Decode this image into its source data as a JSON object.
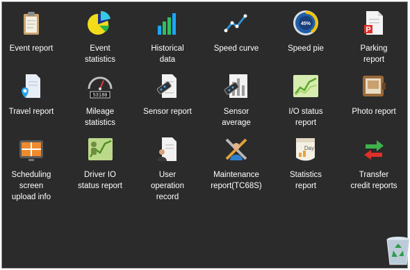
{
  "tiles": [
    {
      "label": "Event report",
      "icon": "clipboard-icon"
    },
    {
      "label": "Event\nstatistics",
      "icon": "pie-chart-icon"
    },
    {
      "label": "Historical\ndata",
      "icon": "bar-chart-icon"
    },
    {
      "label": "Speed curve",
      "icon": "line-chart-icon"
    },
    {
      "label": "Speed pie",
      "icon": "speed-gauge-icon",
      "gauge_text": "45%"
    },
    {
      "label": "Parking\nreport",
      "icon": "parking-document-icon",
      "badge": "P"
    },
    {
      "label": "Travel report",
      "icon": "location-document-icon"
    },
    {
      "label": "Mileage\nstatistics",
      "icon": "odometer-icon",
      "odometer_text": "53180"
    },
    {
      "label": "Sensor report",
      "icon": "sensor-document-icon"
    },
    {
      "label": "Sensor\naverage",
      "icon": "sensor-average-icon"
    },
    {
      "label": "I/O status\nreport",
      "icon": "io-status-chart-icon"
    },
    {
      "label": "Photo report",
      "icon": "photo-wallet-icon"
    },
    {
      "label": "Scheduling\nscreen\nupload info",
      "icon": "scheduling-screen-icon"
    },
    {
      "label": "Driver IO\nstatus report",
      "icon": "driver-io-chart-icon"
    },
    {
      "label": "User\noperation\nrecord",
      "icon": "user-document-icon"
    },
    {
      "label": "Maintenance\nreport(TC68S)",
      "icon": "maintenance-tools-icon"
    },
    {
      "label": "Statistics\nreport",
      "icon": "calendar-statistics-icon",
      "calendar_text": "Day"
    },
    {
      "label": "Transfer\ncredit reports",
      "icon": "transfer-arrows-icon"
    }
  ],
  "trash": {
    "icon": "recycle-bin-icon"
  }
}
